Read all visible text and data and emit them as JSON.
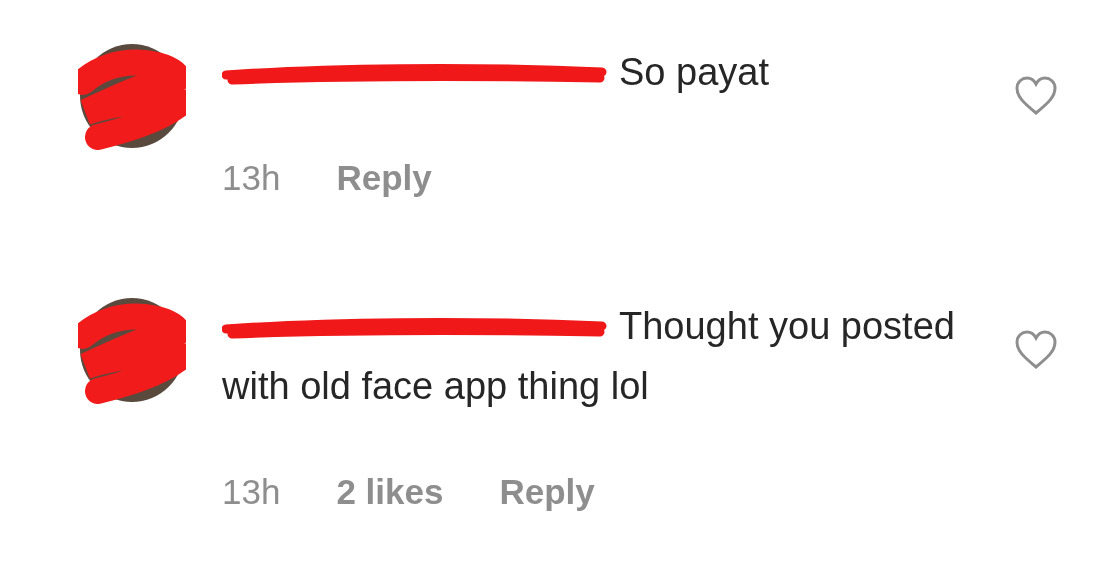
{
  "comments": [
    {
      "redacted": true,
      "text": "So payat",
      "time": "13h",
      "reply": "Reply",
      "liked": false
    },
    {
      "redacted": true,
      "text": "Thought you posted with old face app thing lol",
      "time": "13h",
      "likes": "2 likes",
      "reply": "Reply",
      "liked": false
    }
  ]
}
